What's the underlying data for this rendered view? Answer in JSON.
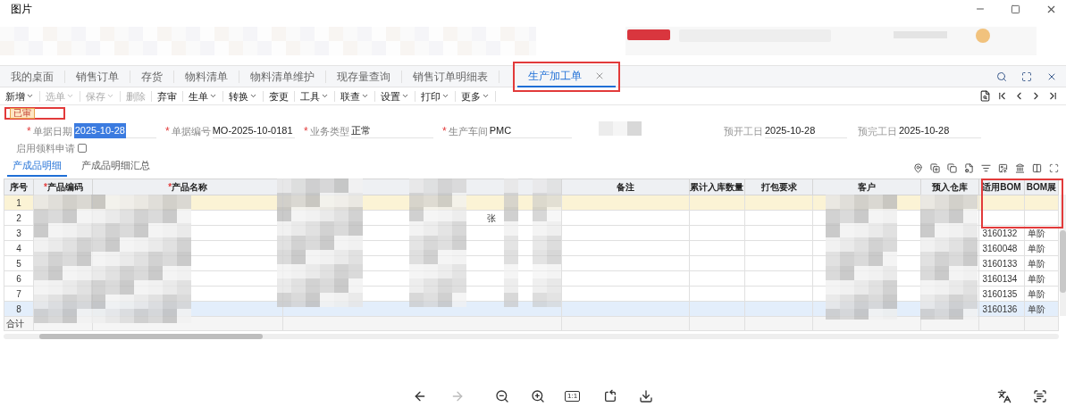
{
  "window": {
    "title": "图片"
  },
  "tabs": [
    {
      "label": "我的桌面",
      "selected": false
    },
    {
      "label": "销售订单",
      "selected": false
    },
    {
      "label": "存货",
      "selected": false
    },
    {
      "label": "物料清单",
      "selected": false
    },
    {
      "label": "物料清单维护",
      "selected": false
    },
    {
      "label": "现存量查询",
      "selected": false
    },
    {
      "label": "销售订单明细表",
      "selected": false
    },
    {
      "label": "生产加工单",
      "selected": true
    }
  ],
  "toolbar": [
    {
      "label": "新增",
      "menu": true,
      "disabled": false
    },
    {
      "label": "选单",
      "menu": true,
      "disabled": true
    },
    {
      "label": "保存",
      "menu": true,
      "disabled": true
    },
    {
      "label": "删除",
      "menu": false,
      "disabled": true
    },
    {
      "label": "弃审",
      "menu": false,
      "disabled": false
    },
    {
      "label": "生单",
      "menu": true,
      "disabled": false
    },
    {
      "label": "转换",
      "menu": true,
      "disabled": false
    },
    {
      "label": "变更",
      "menu": false,
      "disabled": false
    },
    {
      "label": "工具",
      "menu": true,
      "disabled": false
    },
    {
      "label": "联查",
      "menu": true,
      "disabled": false
    },
    {
      "label": "设置",
      "menu": true,
      "disabled": false
    },
    {
      "label": "打印",
      "menu": true,
      "disabled": false
    },
    {
      "label": "更多",
      "menu": true,
      "disabled": false
    }
  ],
  "status_badge": "已审",
  "required_mark": "*",
  "fields": [
    {
      "label": "单据日期",
      "value": "2025-10-28",
      "required": true,
      "highlighted": true
    },
    {
      "label": "单据编号",
      "value": "MO-2025-10-0181",
      "required": true,
      "highlighted": false
    },
    {
      "label": "业务类型",
      "value": "正常",
      "required": true,
      "highlighted": false
    },
    {
      "label": "生产车间",
      "value": "PMC",
      "required": true,
      "highlighted": false
    },
    {
      "label": "预开工日",
      "value": "2025-10-28",
      "required": false,
      "highlighted": false
    },
    {
      "label": "预完工日",
      "value": "2025-10-28",
      "required": false,
      "highlighted": false
    }
  ],
  "material_request": {
    "label": "启用领料申请",
    "checked": false
  },
  "sub_tabs": [
    {
      "label": "产成品明细",
      "selected": true
    },
    {
      "label": "产成品明细汇总",
      "selected": false
    }
  ],
  "table": {
    "columns": [
      {
        "label": "序号",
        "required": false
      },
      {
        "label": "产品编码",
        "required": true
      },
      {
        "label": "产品名称",
        "required": true
      },
      {
        "label": "备注",
        "required": false
      },
      {
        "label": "累计入库数量",
        "required": false
      },
      {
        "label": "打包要求",
        "required": false
      },
      {
        "label": "客户",
        "required": false
      },
      {
        "label": "预入仓库",
        "required": false
      },
      {
        "label": "适用BOM",
        "required": false
      },
      {
        "label": "BOM展",
        "required": false
      }
    ],
    "rows": [
      {
        "seq": "1",
        "editing": true,
        "selected": false
      },
      {
        "seq": "2",
        "unit": "张",
        "editing": false,
        "selected": false
      },
      {
        "seq": "3",
        "bom": "3160132",
        "bom_expand": "单阶",
        "editing": false,
        "selected": false
      },
      {
        "seq": "4",
        "bom": "3160048",
        "bom_expand": "单阶",
        "editing": false,
        "selected": false
      },
      {
        "seq": "5",
        "bom": "3160133",
        "bom_expand": "单阶",
        "editing": false,
        "selected": false
      },
      {
        "seq": "6",
        "bom": "3160134",
        "bom_expand": "单阶",
        "editing": false,
        "selected": false
      },
      {
        "seq": "7",
        "bom": "3160135",
        "bom_expand": "单阶",
        "editing": false,
        "selected": false
      },
      {
        "seq": "8",
        "bom": "3160136",
        "bom_expand": "单阶",
        "editing": false,
        "selected": true
      }
    ],
    "total_label": "合计"
  },
  "viewer_toolbar": {
    "actual_size": "1:1"
  }
}
